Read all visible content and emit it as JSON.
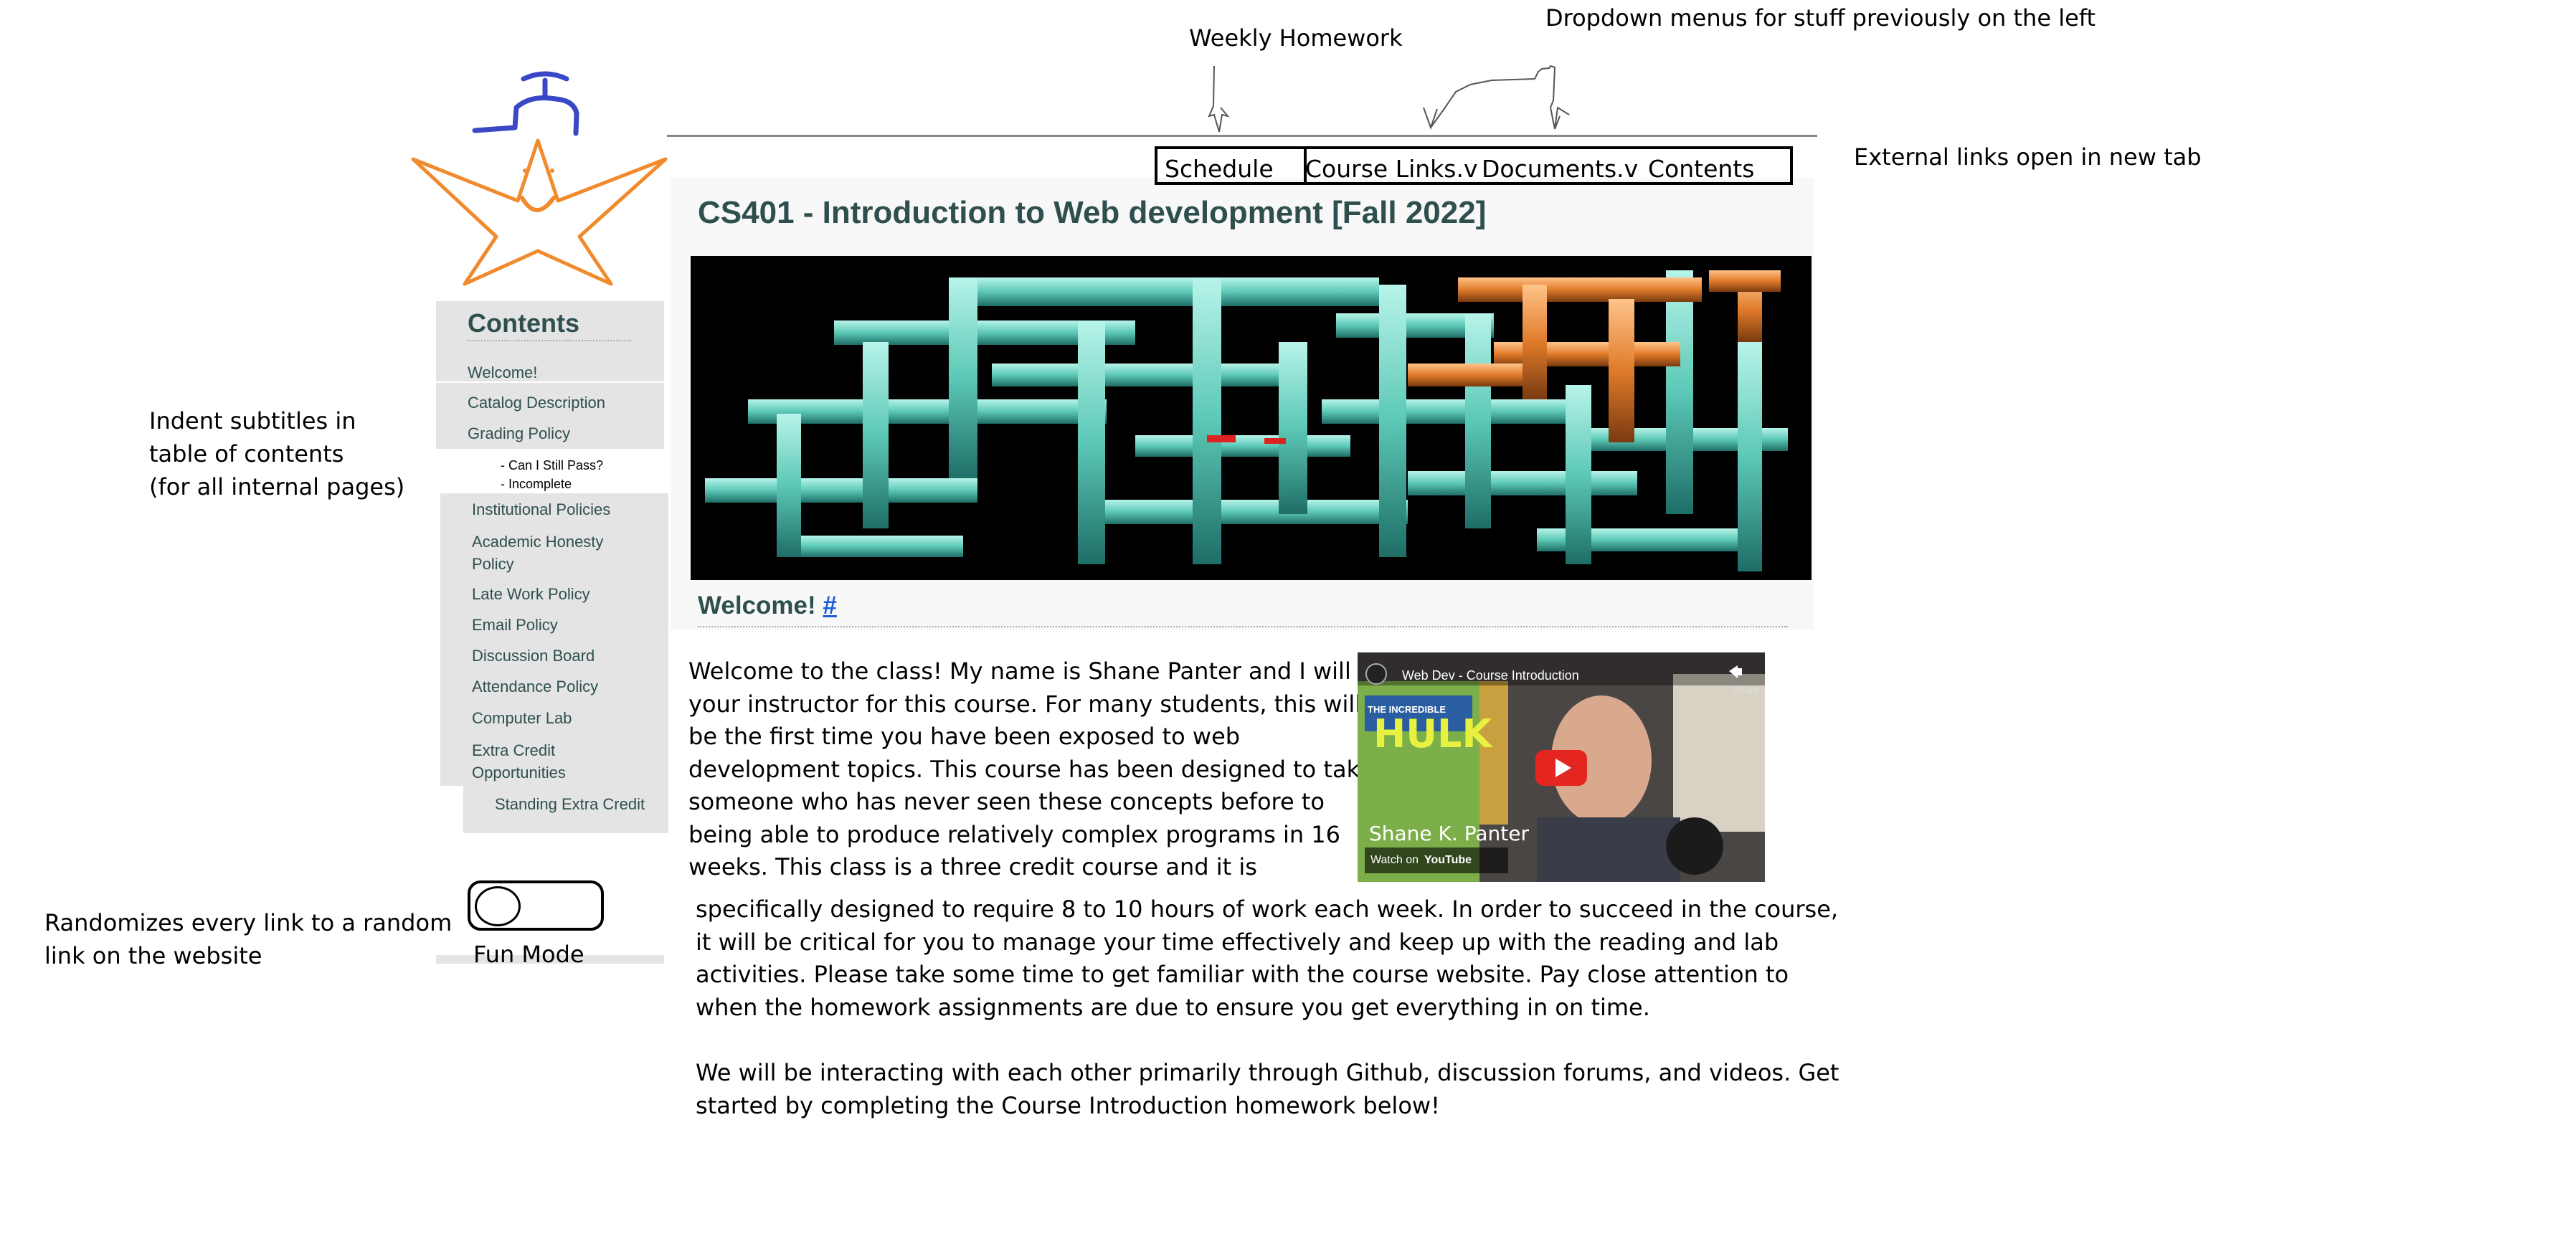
{
  "annotations": {
    "weekly_homework": "Weekly Homework",
    "dropdown_menus": "Dropdown menus for stuff previously on the left",
    "external_links": "External links open in new tab",
    "indent_subtitles": [
      "Indent subtitles in",
      "table of contents",
      "(for all internal pages)"
    ],
    "randomizes": [
      "Randomizes every link to a random",
      "link on the website"
    ]
  },
  "nav": {
    "schedule": "Schedule",
    "course_links": "Course Links.v",
    "documents": "Documents.v",
    "contents": "Contents"
  },
  "page": {
    "title": "CS401 - Introduction to Web development [Fall 2022]",
    "welcome_heading": "Welcome!",
    "welcome_anchor": "#"
  },
  "toc": {
    "heading": "Contents",
    "items": [
      "Welcome!",
      "Catalog Description",
      "Grading Policy",
      "Institutional Policies",
      "Academic Honesty",
      "Policy",
      "Late Work Policy",
      "Email Policy",
      "Discussion Board",
      "Attendance Policy",
      "Computer Lab",
      "Extra Credit",
      "Opportunities",
      "Standing Extra Credit"
    ],
    "subitems": [
      "- Can I Still Pass?",
      "- Incomplete"
    ]
  },
  "video": {
    "title": "Web Dev - Course Introduction",
    "share": "Share",
    "presenter": "Shane K. Panter",
    "watch_on": "Watch on",
    "platform": "YouTube",
    "comic_title": "HULK",
    "comic_top": "THE INCREDIBLE"
  },
  "body": {
    "lines_narrow": [
      "Welcome to the class! My name is Shane Panter and I will be",
      "your instructor for this course. For many students, this will",
      "be the first time you have been exposed to web",
      "development topics. This course has been designed to take",
      "someone who has never seen these concepts before to",
      "being able to produce relatively complex programs in 16",
      "weeks. This class is a three credit course and it is"
    ],
    "lines_wide": [
      "specifically designed to require 8 to 10 hours of work each week. In order to succeed in the course,",
      "it will be critical for you to manage your time effectively and keep up with the reading and lab",
      "activities. Please take some time to get familiar with the course website. Pay close attention to",
      "when the homework assignments are due to ensure you get everything in on time."
    ],
    "lines_final": [
      "We will be interacting with each other primarily through Github, discussion forums, and videos. Get",
      "started by completing the Course Introduction homework below!"
    ]
  },
  "fun_mode": {
    "label": "Fun Mode"
  },
  "colors": {
    "heading": "#2f4f4f",
    "star": "#f08a2c",
    "hat": "#3a48c8",
    "banner_cyan": "#6fd6c6",
    "banner_orange": "#e07b2a",
    "link": "#1a5fd6"
  }
}
